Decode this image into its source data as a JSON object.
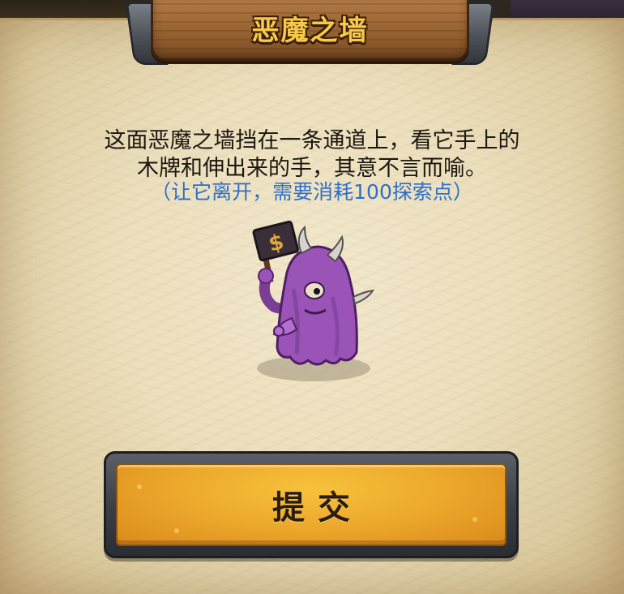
{
  "dialog": {
    "title": "恶魔之墙",
    "description_lines": [
      "这面恶魔之墙挡在一条通道上，看它手上的",
      "木牌和伸出来的手，其意不言而喻。"
    ],
    "hint": "（让它离开，需要消耗100探索点）",
    "submit_label": "提交"
  },
  "colors": {
    "title_text": "#f6c94a",
    "hint_text": "#2d6fc7",
    "button_fill": "#eba52a",
    "monster_body": "#9a54b8"
  },
  "icons": {
    "sign_symbol": "$"
  }
}
